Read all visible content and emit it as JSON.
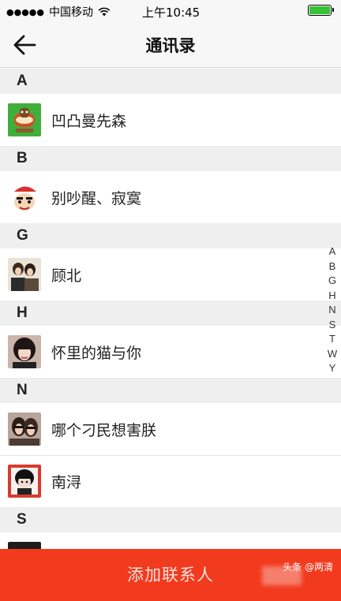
{
  "status_bar": {
    "signal": "●●●●●",
    "carrier": "中国移动",
    "time": "上午10:45"
  },
  "nav": {
    "title": "通讯录"
  },
  "sections": [
    {
      "letter": "A",
      "contacts": [
        "凹凸曼先森"
      ]
    },
    {
      "letter": "B",
      "contacts": [
        "别吵醒、寂寞"
      ]
    },
    {
      "letter": "G",
      "contacts": [
        "顾北"
      ]
    },
    {
      "letter": "H",
      "contacts": [
        "怀里的猫与你"
      ]
    },
    {
      "letter": "N",
      "contacts": [
        "哪个刁民想害朕",
        "南浔"
      ]
    },
    {
      "letter": "S",
      "contacts": [
        ""
      ]
    }
  ],
  "index_letters": [
    "A",
    "B",
    "G",
    "H",
    "N",
    "S",
    "T",
    "W",
    "Y"
  ],
  "add_button_label": "添加联系人",
  "watermark": "头条 @两清",
  "colors": {
    "accent": "#f23a1e",
    "section_bg": "#efefef",
    "battery": "#35c235"
  }
}
